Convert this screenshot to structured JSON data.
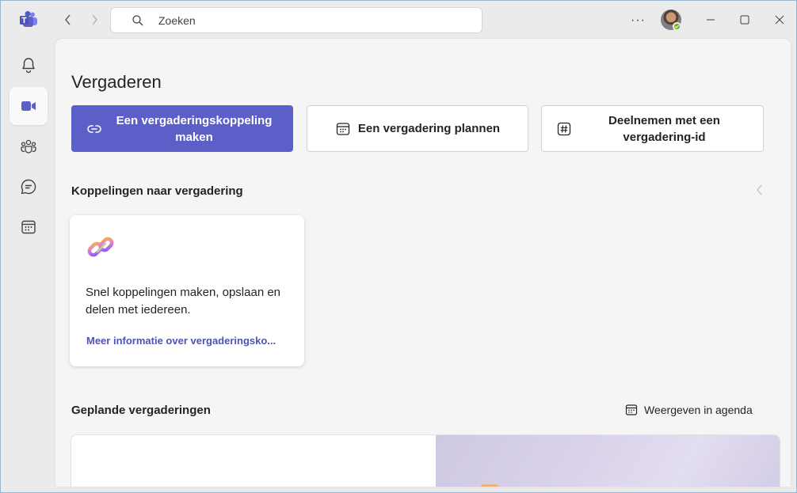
{
  "titlebar": {
    "search_placeholder": "Zoeken",
    "more_label": "···"
  },
  "rail": {
    "items": [
      {
        "name": "activity",
        "icon": "bell-icon"
      },
      {
        "name": "meetings",
        "icon": "video-camera-icon",
        "active": true
      },
      {
        "name": "teams",
        "icon": "people-community-icon"
      },
      {
        "name": "chat",
        "icon": "chat-icon"
      },
      {
        "name": "calendar",
        "icon": "calendar-icon"
      }
    ]
  },
  "main": {
    "title": "Vergaderen",
    "actions": {
      "create_link": "Een vergaderingskoppeling maken",
      "schedule": "Een vergadering plannen",
      "join_id": "Deelnemen met een vergadering-id"
    },
    "links_section": {
      "title": "Koppelingen naar vergadering",
      "card": {
        "description": "Snel koppelingen maken, opslaan en delen met iedereen.",
        "link": "Meer informatie over vergaderingsko..."
      }
    },
    "scheduled_section": {
      "title": "Geplande vergaderingen",
      "view_calendar": "Weergeven in agenda"
    }
  },
  "colors": {
    "accent": "#5b5fc7",
    "link": "#4f52b2",
    "presence_available": "#6bb700"
  }
}
